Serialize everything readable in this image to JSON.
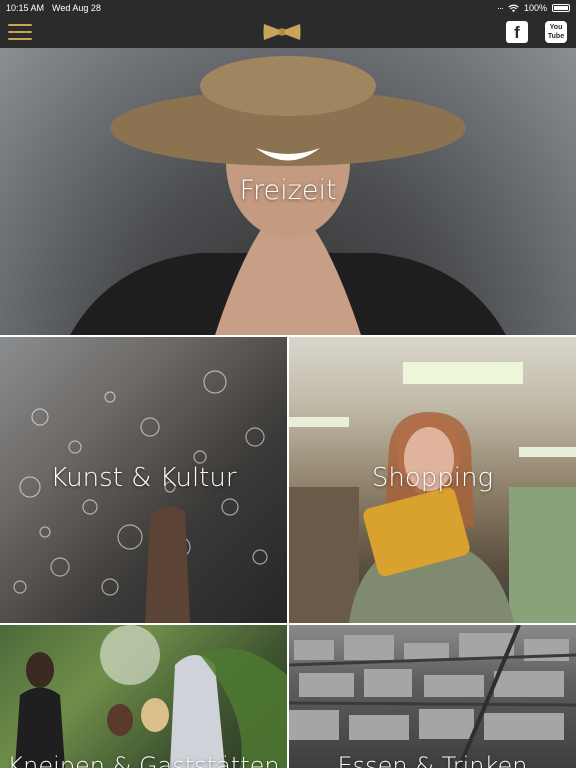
{
  "status_bar": {
    "time": "10:15 AM",
    "date": "Wed Aug 28",
    "battery": "100%"
  },
  "nav": {
    "facebook_glyph": "f",
    "youtube_glyph": "You Tube",
    "brand_color": "#c9a45a",
    "bar_color": "#2b2b2b"
  },
  "tiles": [
    {
      "label": "Freizeit"
    },
    {
      "label": "Kunst & Kultur"
    },
    {
      "label": "Shopping"
    },
    {
      "label": "Kneipen & Gaststätten"
    },
    {
      "label": "Essen & Trinken"
    }
  ]
}
